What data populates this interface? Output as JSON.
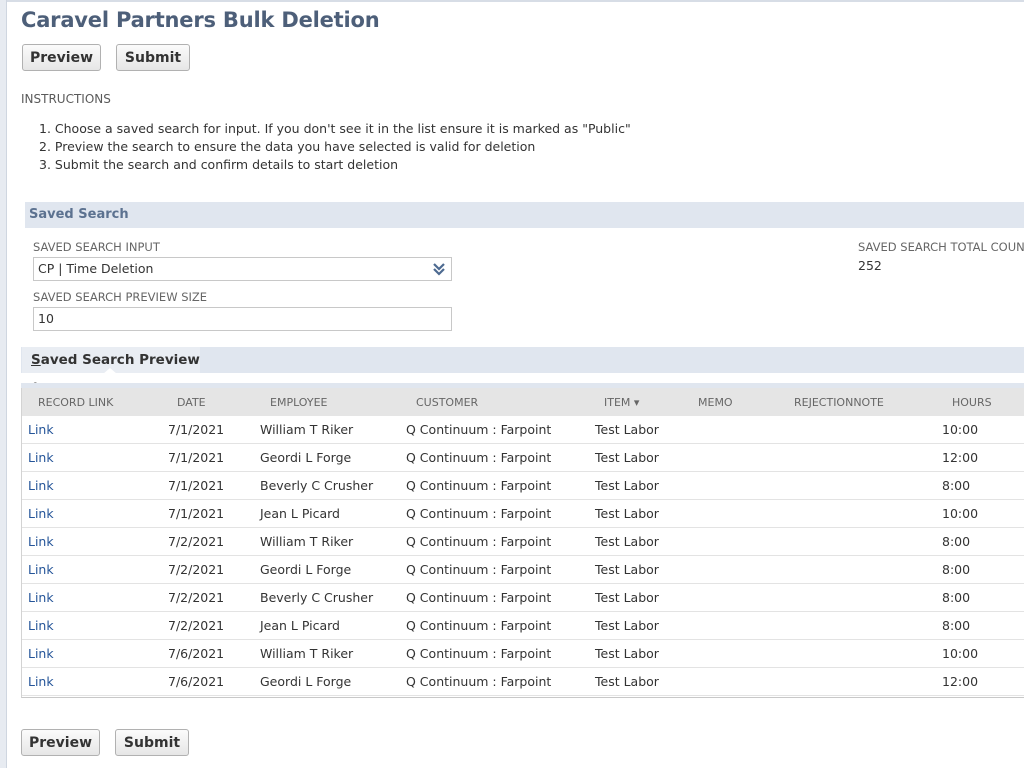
{
  "page": {
    "title": "Caravel Partners Bulk Deletion"
  },
  "top_buttons": {
    "preview": "Preview",
    "submit": "Submit"
  },
  "instructions": {
    "label": "INSTRUCTIONS",
    "steps": [
      "1. Choose a saved search for input. If you don't see it in the list ensure it is marked as \"Public\"",
      "2. Preview the search to ensure the data you have selected is valid for deletion",
      "3. Submit the search and confirm details to start deletion"
    ]
  },
  "saved_search": {
    "section_title": "Saved Search",
    "input_label": "SAVED SEARCH INPUT",
    "input_value": "CP | Time Deletion",
    "preview_size_label": "SAVED SEARCH PREVIEW SIZE",
    "preview_size_value": "10",
    "total_count_label": "SAVED SEARCH TOTAL COUNT",
    "total_count_value": "252"
  },
  "preview_tab": {
    "label_first": "S",
    "label_rest": "aved Search Preview •"
  },
  "table": {
    "columns": [
      "RECORD LINK",
      "DATE",
      "EMPLOYEE",
      "CUSTOMER",
      "ITEM ▾",
      "MEMO",
      "REJECTIONNOTE",
      "HOURS"
    ],
    "rows": [
      [
        "Link",
        "7/1/2021",
        "William T Riker",
        "Q Continuum : Farpoint",
        "Test Labor",
        "",
        "",
        "10:00"
      ],
      [
        "Link",
        "7/1/2021",
        "Geordi L Forge",
        "Q Continuum : Farpoint",
        "Test Labor",
        "",
        "",
        "12:00"
      ],
      [
        "Link",
        "7/1/2021",
        "Beverly C Crusher",
        "Q Continuum : Farpoint",
        "Test Labor",
        "",
        "",
        "8:00"
      ],
      [
        "Link",
        "7/1/2021",
        "Jean L Picard",
        "Q Continuum : Farpoint",
        "Test Labor",
        "",
        "",
        "10:00"
      ],
      [
        "Link",
        "7/2/2021",
        "William T Riker",
        "Q Continuum : Farpoint",
        "Test Labor",
        "",
        "",
        "8:00"
      ],
      [
        "Link",
        "7/2/2021",
        "Geordi L Forge",
        "Q Continuum : Farpoint",
        "Test Labor",
        "",
        "",
        "8:00"
      ],
      [
        "Link",
        "7/2/2021",
        "Beverly C Crusher",
        "Q Continuum : Farpoint",
        "Test Labor",
        "",
        "",
        "8:00"
      ],
      [
        "Link",
        "7/2/2021",
        "Jean L Picard",
        "Q Continuum : Farpoint",
        "Test Labor",
        "",
        "",
        "8:00"
      ],
      [
        "Link",
        "7/6/2021",
        "William T Riker",
        "Q Continuum : Farpoint",
        "Test Labor",
        "",
        "",
        "10:00"
      ],
      [
        "Link",
        "7/6/2021",
        "Geordi L Forge",
        "Q Continuum : Farpoint",
        "Test Labor",
        "",
        "",
        "12:00"
      ]
    ]
  },
  "bottom_buttons": {
    "preview": "Preview",
    "submit": "Submit"
  },
  "colors": {
    "title": "#4d5f79",
    "section_bar": "#e0e6ef",
    "link": "#255599"
  }
}
